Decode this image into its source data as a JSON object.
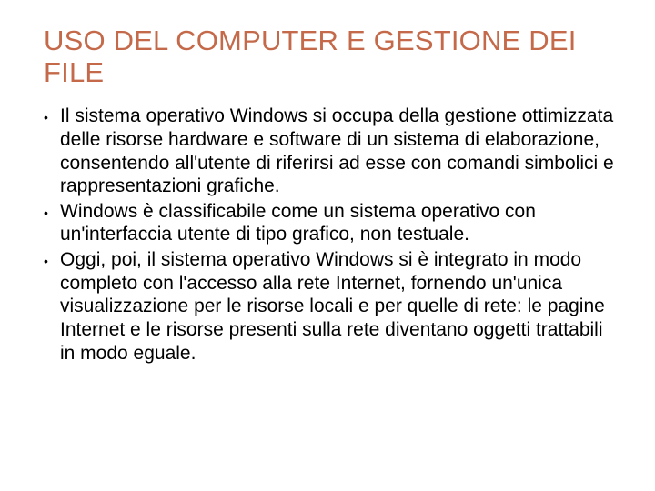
{
  "title": "USO DEL COMPUTER E GESTIONE DEI FILE",
  "bullets": [
    "Il sistema operativo Windows si occupa della gestione ottimizzata delle risorse hardware e software di un sistema di elaborazione, consentendo all'utente di riferirsi ad esse con comandi simbolici e rappresentazioni grafiche.",
    "Windows è classificabile come un sistema operativo con un'interfaccia utente di tipo grafico, non testuale.",
    "Oggi, poi, il sistema operativo Windows si è integrato in modo completo con l'accesso alla rete Internet, fornendo un'unica visualizzazione per le risorse locali e per quelle di rete: le pagine Internet e le risorse presenti sulla rete diventano oggetti trattabili in modo eguale."
  ]
}
